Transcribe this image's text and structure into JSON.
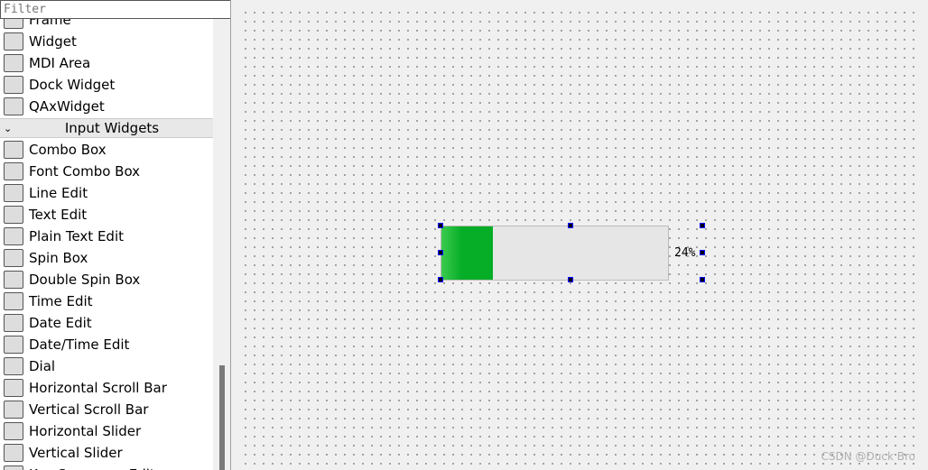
{
  "filter": {
    "placeholder": "Filter"
  },
  "widgets_before": [
    {
      "label": "Frame",
      "icon": "frame-icon"
    },
    {
      "label": "Widget",
      "icon": "widget-icon"
    },
    {
      "label": "MDI Area",
      "icon": "mdi-area-icon"
    },
    {
      "label": "Dock Widget",
      "icon": "dock-widget-icon"
    },
    {
      "label": "QAxWidget",
      "icon": "qaxwidget-icon"
    }
  ],
  "category": {
    "label": "Input Widgets",
    "expanded": true
  },
  "widgets_after": [
    {
      "label": "Combo Box",
      "icon": "combo-box-icon"
    },
    {
      "label": "Font Combo Box",
      "icon": "font-combo-box-icon"
    },
    {
      "label": "Line Edit",
      "icon": "line-edit-icon"
    },
    {
      "label": "Text Edit",
      "icon": "text-edit-icon"
    },
    {
      "label": "Plain Text Edit",
      "icon": "plain-text-edit-icon"
    },
    {
      "label": "Spin Box",
      "icon": "spin-box-icon"
    },
    {
      "label": "Double Spin Box",
      "icon": "double-spin-box-icon"
    },
    {
      "label": "Time Edit",
      "icon": "time-edit-icon"
    },
    {
      "label": "Date Edit",
      "icon": "date-edit-icon"
    },
    {
      "label": "Date/Time Edit",
      "icon": "datetime-edit-icon"
    },
    {
      "label": "Dial",
      "icon": "dial-icon"
    },
    {
      "label": "Horizontal Scroll Bar",
      "icon": "horizontal-scroll-bar-icon"
    },
    {
      "label": "Vertical Scroll Bar",
      "icon": "vertical-scroll-bar-icon"
    },
    {
      "label": "Horizontal Slider",
      "icon": "horizontal-slider-icon"
    },
    {
      "label": "Vertical Slider",
      "icon": "vertical-slider-icon"
    },
    {
      "label": "Key Sequence Edit",
      "icon": "key-sequence-edit-icon"
    }
  ],
  "progress": {
    "value": 24,
    "text": "24%",
    "color": "#06ad27"
  },
  "watermark": "CSDN @Duck Bro"
}
